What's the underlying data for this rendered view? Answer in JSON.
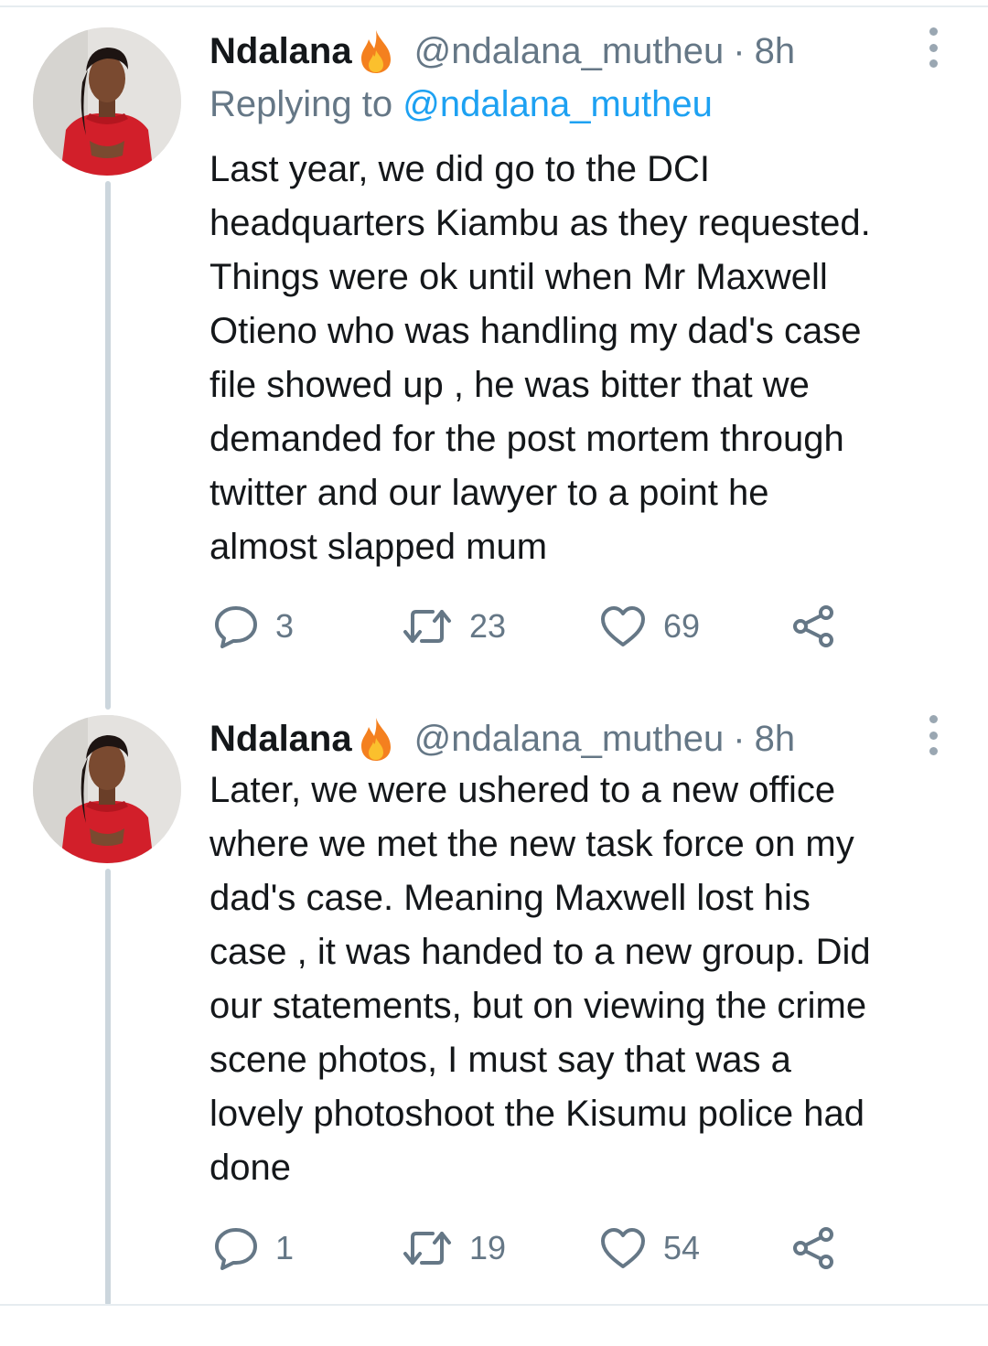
{
  "tweets": [
    {
      "name": "Ndalana",
      "handle": "@ndalana_mutheu",
      "separator": "·",
      "time": "8h",
      "replying_label": "Replying to",
      "replying_to": "@ndalana_mutheu",
      "text_lines": [
        "Last year, we did go to the DCI",
        "headquarters Kiambu as they requested.",
        "Things were ok until when Mr Maxwell",
        "Otieno who was handling my dad's case",
        "file showed up , he was bitter that we",
        "demanded for the post mortem through",
        "twitter and our lawyer to a point he",
        "almost slapped mum"
      ],
      "replies": "3",
      "retweets": "23",
      "likes": "69"
    },
    {
      "name": "Ndalana",
      "handle": "@ndalana_mutheu",
      "separator": "·",
      "time": "8h",
      "text_lines": [
        "Later, we were ushered to a new office",
        "where we met the new task force on my",
        "dad's case. Meaning Maxwell lost his",
        "case , it was handed to a new group. Did",
        "our statements, but on viewing the crime",
        "scene photos, I must say that was a",
        "lovely photoshoot the Kisumu police had",
        "done"
      ],
      "replies": "1",
      "retweets": "19",
      "likes": "54"
    }
  ],
  "icons": {
    "name_emoji": "flame-icon",
    "more": "more-vertical-icon",
    "reply": "reply-icon",
    "retweet": "retweet-icon",
    "like": "heart-icon",
    "share": "share-icon"
  },
  "colors": {
    "link": "#1da1f2",
    "secondary_text": "#657786",
    "primary_text": "#14171a",
    "thread_line": "#ccd6dd"
  }
}
